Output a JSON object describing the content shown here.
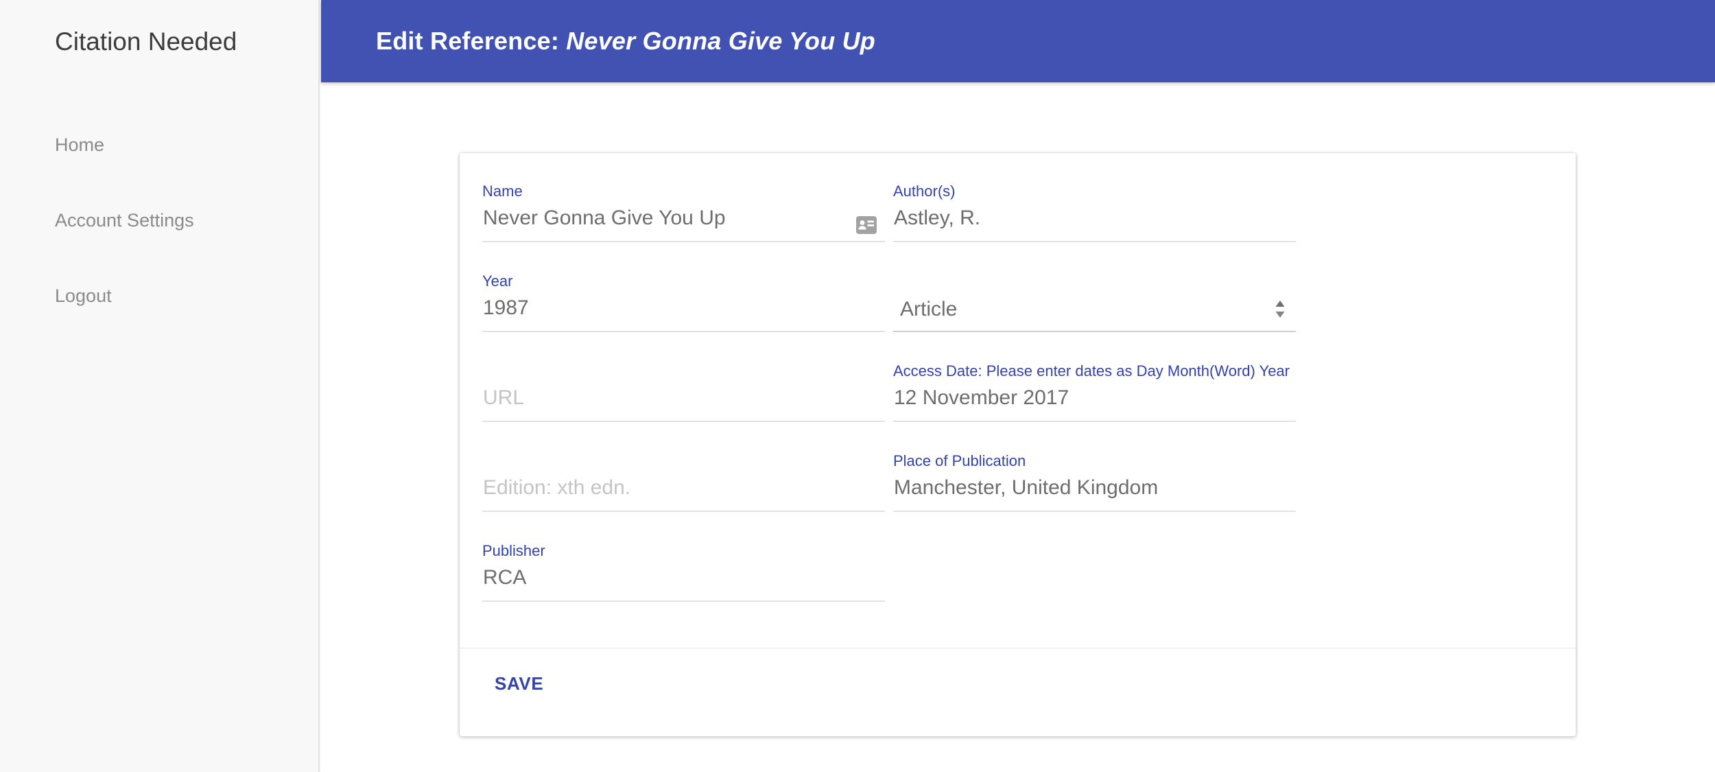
{
  "app": {
    "brand": "Citation Needed"
  },
  "sidebar": {
    "items": [
      {
        "label": "Home"
      },
      {
        "label": "Account Settings"
      },
      {
        "label": "Logout"
      }
    ]
  },
  "header": {
    "title_prefix": "Edit Reference: ",
    "title_reference": "Never Gonna Give You Up"
  },
  "form": {
    "fields": {
      "name": {
        "label": "Name",
        "value": "Never Gonna Give You Up"
      },
      "authors": {
        "label": "Author(s)",
        "value": "Astley, R."
      },
      "year": {
        "label": "Year",
        "value": "1987"
      },
      "type": {
        "value": "Article"
      },
      "url": {
        "placeholder": "URL"
      },
      "access_date": {
        "label": "Access Date: Please enter dates as Day Month(Word) Year",
        "value": "12 November 2017"
      },
      "edition": {
        "placeholder": "Edition: xth edn."
      },
      "place": {
        "label": "Place of Publication",
        "value": "Manchester, United Kingdom"
      },
      "publisher": {
        "label": "Publisher",
        "value": "RCA"
      }
    },
    "save_label": "SAVE"
  },
  "icons": {
    "name_input_icon": "contact-card-autofill-icon",
    "type_select_icon": "updown-arrows-icon"
  },
  "colors": {
    "header_bg": "#4152b3",
    "accent": "#3342ae",
    "value_text": "#6d6d6d",
    "placeholder_text": "#c4c4c4",
    "sidebar_bg": "#f8f8f8",
    "nav_text": "#8a8a8a"
  }
}
